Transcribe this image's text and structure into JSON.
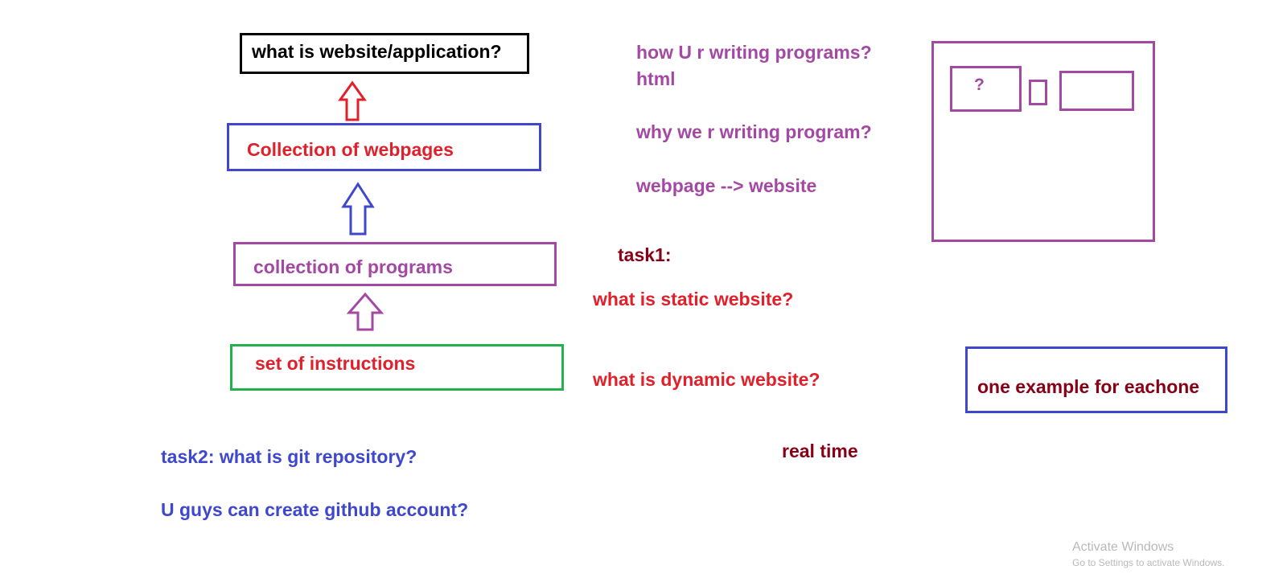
{
  "colors": {
    "black": "#000000",
    "red": "#e0202a",
    "blue": "#3f48cc",
    "purple": "#a349a4",
    "green": "#22b14c",
    "maroon": "#880015",
    "watermark": "#b9b9b9"
  },
  "flow": {
    "top_box": "what is website/application?",
    "webpages_box": "Collection of webpages",
    "programs_box": "collection of programs",
    "instructions_box": "set of instructions"
  },
  "notes": {
    "how_writing": "how U r writing programs?",
    "html": "html",
    "why_writing": "why we r writing program?",
    "webpage_website": "webpage --> website",
    "task1": "task1:",
    "static": "what is static website?",
    "dynamic": "what is dynamic website?",
    "example": "one example for eachone",
    "real_time": "real time",
    "task2": "task2: what is git repository?",
    "github": "U guys can create github account?"
  },
  "sketch": {
    "question_mark": "?"
  },
  "watermark": {
    "line1": "Activate Windows",
    "line2": "Go to Settings to activate Windows."
  }
}
